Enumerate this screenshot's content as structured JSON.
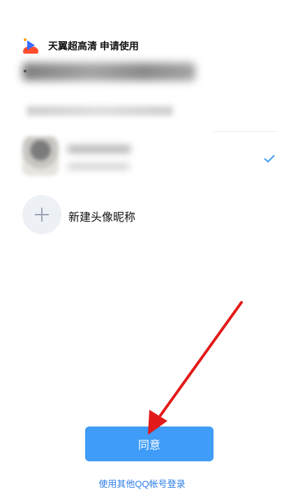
{
  "header": {
    "title": "天翼超高清 申请使用",
    "logo_icon": "app-logo-icon"
  },
  "account": {
    "selected_icon": "checkmark-icon",
    "check_color": "#3f9cf8"
  },
  "new_avatar": {
    "label": "新建头像昵称",
    "icon": "plus-icon"
  },
  "actions": {
    "agree_label": "同意",
    "other_login_label": "使用其他QQ帐号登录"
  },
  "colors": {
    "primary": "#3f9cf8",
    "link": "#2b7de9",
    "annotation_arrow": "#e21a1a"
  }
}
